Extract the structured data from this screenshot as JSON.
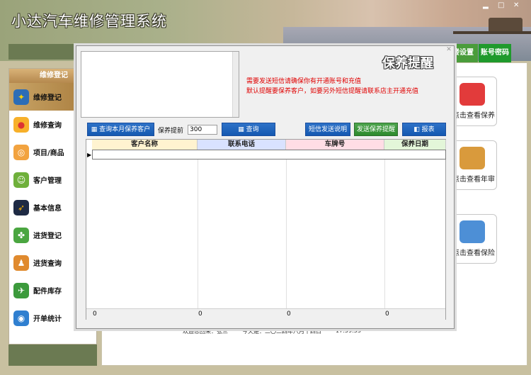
{
  "app": {
    "title": "小达汽车维修管理系统"
  },
  "topbar": {
    "settings": "楼设置",
    "account": "账号密码",
    "tabs_colors": [
      "#4a9c3b",
      "#1f9a2c"
    ]
  },
  "sidebar": {
    "header": "维修登记",
    "items": [
      {
        "label": "维修登记",
        "icon": "wrench-icon"
      },
      {
        "label": "维修查询",
        "icon": "bird-icon"
      },
      {
        "label": "项目/商品",
        "icon": "ring-icon"
      },
      {
        "label": "客户管理",
        "icon": "people-icon"
      },
      {
        "label": "基本信息",
        "icon": "rocket-icon"
      },
      {
        "label": "进货登记",
        "icon": "clover-icon"
      },
      {
        "label": "进货查询",
        "icon": "users-icon"
      },
      {
        "label": "配件库存",
        "icon": "plane-icon"
      },
      {
        "label": "开单统计",
        "icon": "globe-icon"
      }
    ]
  },
  "cards": [
    {
      "label": "点击查看保养",
      "icon": "clipboard-icon"
    },
    {
      "label": "点击查看年审",
      "icon": "box-icon"
    },
    {
      "label": "点击查看保险",
      "icon": "chart-icon"
    }
  ],
  "status": {
    "welcome": "欢迎您回来：张三",
    "date": "今天是：二〇二四年八月十四日",
    "time": "17:59:53"
  },
  "dialog": {
    "title": "保养提醒",
    "note1": "需要发送短信请确保你有开通账号和充值",
    "note2": "默认提醒要保养客户，如要另外短信提醒请联系店主开通充值",
    "btn_month": "查询本月保养客户",
    "days_label": "保养提前",
    "days_value": "300",
    "btn_query": "查询",
    "btn_sms_help": "短信发送说明",
    "btn_send": "发送保养提醒",
    "btn_report": "报表",
    "grid": {
      "columns": [
        "客户名称",
        "联系电话",
        "车牌号",
        "保养日期"
      ],
      "footer": [
        "0",
        "0",
        "0",
        "0"
      ]
    }
  }
}
